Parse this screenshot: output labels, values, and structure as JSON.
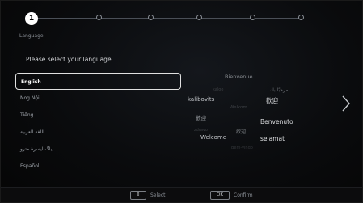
{
  "stepper": {
    "active_step": "1",
    "steps_total": 6,
    "label": "Language"
  },
  "heading": "Please select your language",
  "languages": [
    {
      "label": "English",
      "selected": true
    },
    {
      "label": "Nog Nội",
      "selected": false
    },
    {
      "label": "Tiếng",
      "selected": false
    },
    {
      "label": "اللغة العربية",
      "selected": false
    },
    {
      "label": "ياگ ليسرة مترو",
      "selected": false
    },
    {
      "label": "Español",
      "selected": false
    }
  ],
  "word_cloud": {
    "bienvenue": "Bienvenue",
    "arabic": "مرحبًا بك",
    "kaloo": "kaloo",
    "kalibovits": "kalibovits",
    "welcome_kr": "歡迎",
    "faded_center": "Welkom",
    "mid_small": "歡迎",
    "benvenuto": "Benvenuto",
    "mid_small2": "歡迎",
    "welcome": "Welcome",
    "selamat": "selamat",
    "zdravo": "zdravo",
    "faded_bottom": "Bem-vindo"
  },
  "footer": {
    "select_key": "⇕",
    "select_label": "Select",
    "confirm_key": "OK",
    "confirm_label": "Confirm"
  },
  "colors": {
    "background": "#0a0b0d",
    "selected_border": "#e0e0e0",
    "muted_text": "#8e939a"
  }
}
